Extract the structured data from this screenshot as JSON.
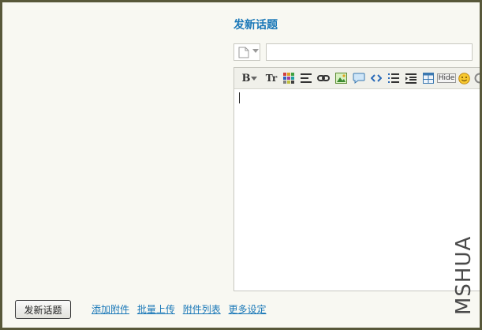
{
  "page": {
    "title": "发新话题"
  },
  "form": {
    "subject_value": "",
    "submit_label": "发新话题"
  },
  "toolbar": {
    "bold_label": "B",
    "font_size_label": "Tr",
    "hide_label": "Hide",
    "tools": [
      "bold-icon",
      "dropdown-icon",
      "font-size-icon",
      "color-icon",
      "align-icon",
      "link-icon",
      "image-icon",
      "quote-icon",
      "code-icon",
      "list-icon",
      "indent-icon",
      "table-icon",
      "hide-icon",
      "smiley-icon",
      "more-icon"
    ]
  },
  "links": {
    "add_attachment": "添加附件",
    "batch_upload": "批量上传",
    "attachment_list": "附件列表",
    "more_settings": "更多设定"
  },
  "watermark": "MSHUA",
  "colors": {
    "background_border": "#58583a",
    "panel": "#f8f8f2",
    "accent_link": "#1a78b8"
  }
}
